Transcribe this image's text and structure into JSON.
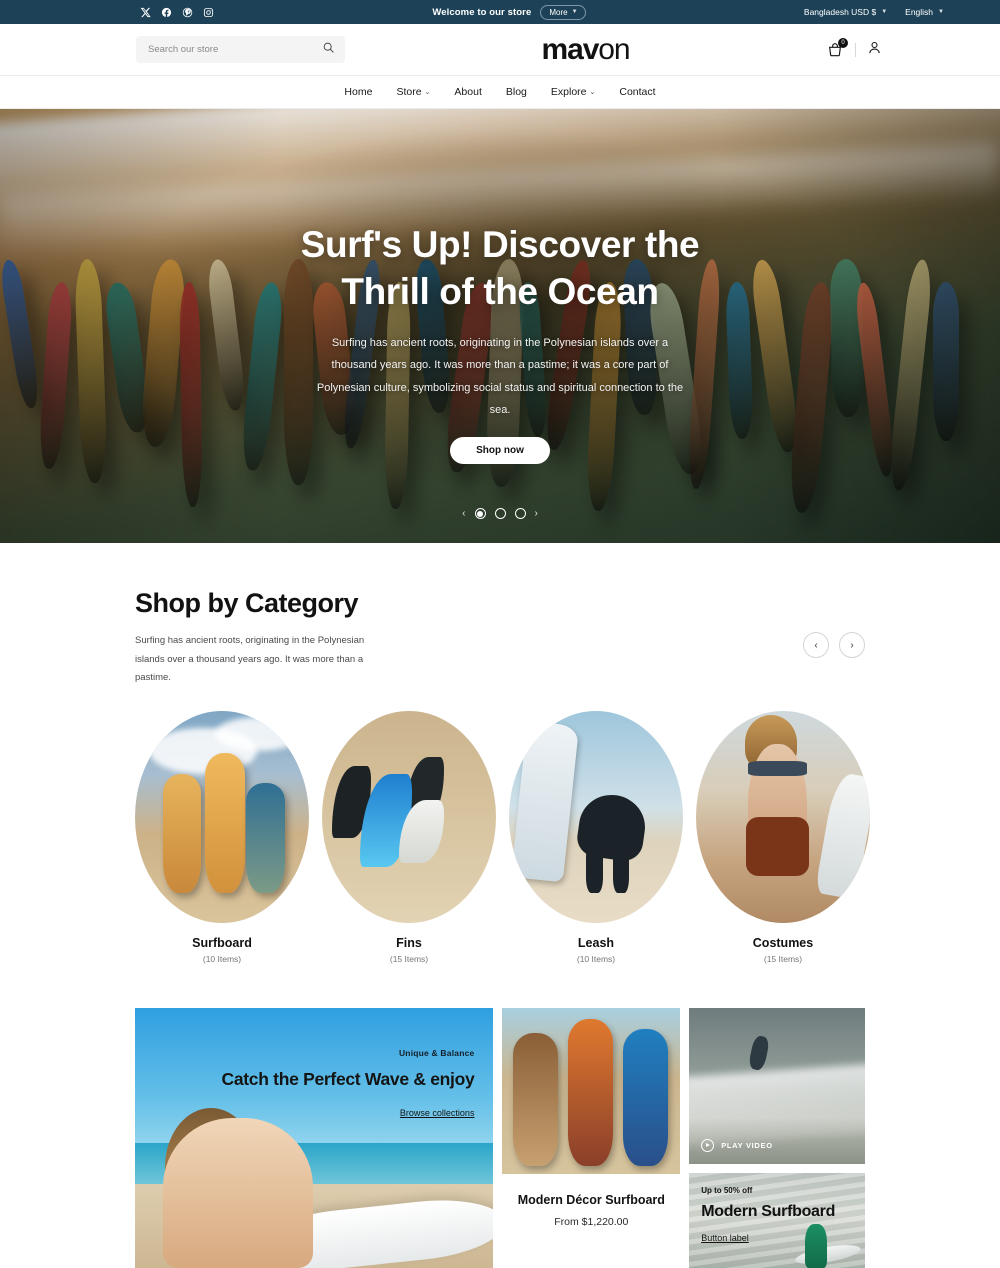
{
  "announcement": {
    "social": [
      {
        "name": "x-twitter-icon",
        "label": "X"
      },
      {
        "name": "facebook-icon",
        "label": "Facebook"
      },
      {
        "name": "pinterest-icon",
        "label": "Pinterest"
      },
      {
        "name": "instagram-icon",
        "label": "Instagram"
      }
    ],
    "welcome": "Welcome to our store",
    "more_label": "More",
    "currency": "Bangladesh USD $",
    "language": "English"
  },
  "header": {
    "search_placeholder": "Search our store",
    "search_value": "",
    "logo_bold": "mav",
    "logo_light": "on",
    "cart_count": "0"
  },
  "nav": {
    "items": [
      {
        "label": "Home",
        "has_dropdown": false
      },
      {
        "label": "Store",
        "has_dropdown": true
      },
      {
        "label": "About",
        "has_dropdown": false
      },
      {
        "label": "Blog",
        "has_dropdown": false
      },
      {
        "label": "Explore",
        "has_dropdown": true
      },
      {
        "label": "Contact",
        "has_dropdown": false
      }
    ]
  },
  "hero": {
    "title": "Surf's Up! Discover the Thrill of the Ocean",
    "subtitle": "Surfing has ancient roots, originating in the Polynesian islands over a thousand years ago. It was more than a pastime; it was a core part of Polynesian culture, symbolizing social status and spiritual connection to the sea.",
    "cta_label": "Shop now",
    "slide_count": 3,
    "active_slide": 1,
    "prev_label": "‹",
    "next_label": "›"
  },
  "categories": {
    "title": "Shop by Category",
    "description": "Surfing has ancient roots, originating in the Polynesian islands over a thousand years ago. It was more than a pastime.",
    "prev_label": "‹",
    "next_label": "›",
    "items": [
      {
        "name": "Surfboard",
        "count": "(10 Items)"
      },
      {
        "name": "Fins",
        "count": "(15 Items)"
      },
      {
        "name": "Leash",
        "count": "(10 Items)"
      },
      {
        "name": "Costumes",
        "count": "(15 Items)"
      }
    ]
  },
  "promo": {
    "left": {
      "eyebrow": "Unique & Balance",
      "heading": "Catch the Perfect Wave & enjoy",
      "link_label": "Browse collections"
    },
    "middle": {
      "product_name": "Modern Décor Surfboard",
      "price": "From $1,220.00"
    },
    "video": {
      "play_label": "PLAY VIDEO"
    },
    "sale": {
      "eyebrow": "Up to 50% off",
      "heading": "Modern Surfboard",
      "link_label": "Button label"
    }
  },
  "colors": {
    "announce_bg": "#1d4258",
    "text_dark": "#121212",
    "muted": "#757575"
  }
}
